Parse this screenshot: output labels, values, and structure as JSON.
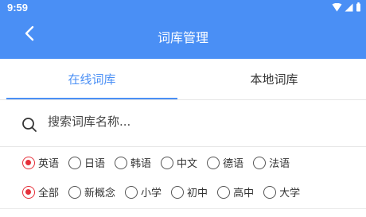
{
  "status": {
    "time": "9:59"
  },
  "header": {
    "title": "词库管理"
  },
  "tabs": [
    {
      "label": "在线词库",
      "active": true
    },
    {
      "label": "本地词库",
      "active": false
    }
  ],
  "search": {
    "placeholder": "搜索词库名称..."
  },
  "languages": [
    {
      "label": "英语",
      "checked": true
    },
    {
      "label": "日语",
      "checked": false
    },
    {
      "label": "韩语",
      "checked": false
    },
    {
      "label": "中文",
      "checked": false
    },
    {
      "label": "德语",
      "checked": false
    },
    {
      "label": "法语",
      "checked": false
    }
  ],
  "levels": [
    {
      "label": "全部",
      "checked": true
    },
    {
      "label": "新概念",
      "checked": false
    },
    {
      "label": "小学",
      "checked": false
    },
    {
      "label": "初中",
      "checked": false
    },
    {
      "label": "高中",
      "checked": false
    },
    {
      "label": "大学",
      "checked": false
    }
  ],
  "colors": {
    "primary": "#4a8ff5",
    "radio_selected": "#e5303a"
  }
}
